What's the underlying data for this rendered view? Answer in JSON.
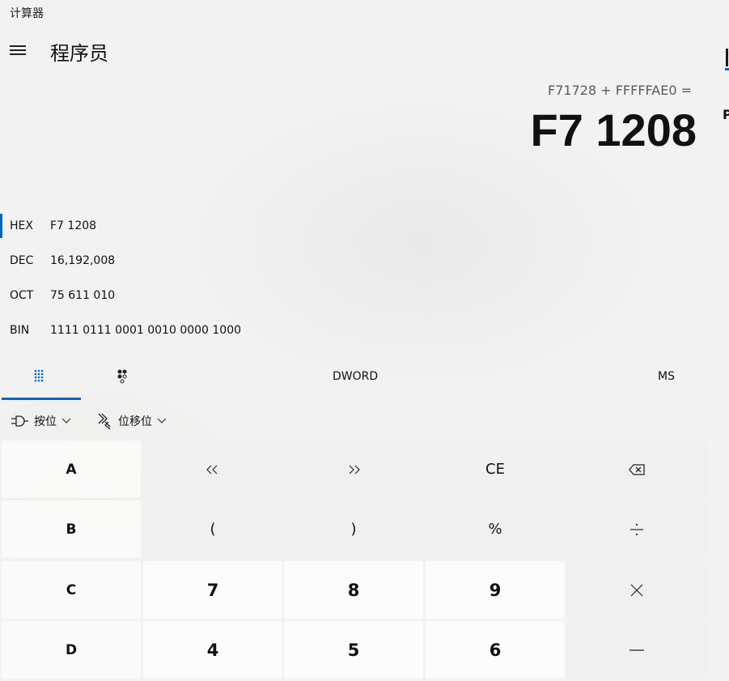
{
  "window": {
    "title": "计算器"
  },
  "header": {
    "mode": "程序员"
  },
  "display": {
    "expression": "F71728 + FFFFFAE0 =",
    "result": "F7 1208"
  },
  "radix": [
    {
      "label": "HEX",
      "value": "F7 1208",
      "selected": true
    },
    {
      "label": "DEC",
      "value": "16,192,008",
      "selected": false
    },
    {
      "label": "OCT",
      "value": "75 611 010",
      "selected": false
    },
    {
      "label": "BIN",
      "value": "1111 0111 0001 0010 0000 1000",
      "selected": false
    }
  ],
  "tabbar": {
    "keypad_icon": "full-keypad-icon",
    "bit_toggle_icon": "bit-toggling-keypad-icon",
    "word_size": "DWORD",
    "memory_store": "MS"
  },
  "tools": {
    "bitwise_label": "按位",
    "bitshift_label": "位移位"
  },
  "keys": {
    "row1": [
      "A",
      "<<",
      ">>",
      "CE",
      "backspace-icon"
    ],
    "row2": [
      "B",
      "(",
      ")",
      "%",
      "divide-icon"
    ],
    "row3": [
      "C",
      "7",
      "8",
      "9",
      "multiply-icon"
    ],
    "row4": [
      "D",
      "4",
      "5",
      "6",
      "minus-icon"
    ]
  },
  "colors": {
    "accent": "#0067c0",
    "background": "#f3f3f3"
  }
}
